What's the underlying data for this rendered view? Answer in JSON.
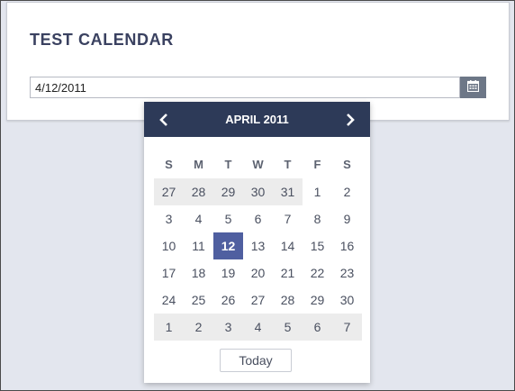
{
  "title": "TEST CALENDAR",
  "date_input": {
    "value": "4/12/2011"
  },
  "calendar_button_icon": "calendar-icon",
  "popup": {
    "month_label": "APRIL 2011",
    "prev_icon": "chevron-left-icon",
    "next_icon": "chevron-right-icon",
    "weekdays": [
      "S",
      "M",
      "T",
      "W",
      "T",
      "F",
      "S"
    ],
    "weeks": [
      [
        {
          "d": "27",
          "other": true
        },
        {
          "d": "28",
          "other": true
        },
        {
          "d": "29",
          "other": true
        },
        {
          "d": "30",
          "other": true
        },
        {
          "d": "31",
          "other": true
        },
        {
          "d": "1"
        },
        {
          "d": "2"
        }
      ],
      [
        {
          "d": "3"
        },
        {
          "d": "4"
        },
        {
          "d": "5"
        },
        {
          "d": "6"
        },
        {
          "d": "7"
        },
        {
          "d": "8"
        },
        {
          "d": "9"
        }
      ],
      [
        {
          "d": "10"
        },
        {
          "d": "11"
        },
        {
          "d": "12",
          "selected": true
        },
        {
          "d": "13"
        },
        {
          "d": "14"
        },
        {
          "d": "15"
        },
        {
          "d": "16"
        }
      ],
      [
        {
          "d": "17"
        },
        {
          "d": "18"
        },
        {
          "d": "19"
        },
        {
          "d": "20"
        },
        {
          "d": "21"
        },
        {
          "d": "22"
        },
        {
          "d": "23"
        }
      ],
      [
        {
          "d": "24"
        },
        {
          "d": "25"
        },
        {
          "d": "26"
        },
        {
          "d": "27"
        },
        {
          "d": "28"
        },
        {
          "d": "29"
        },
        {
          "d": "30"
        }
      ],
      [
        {
          "d": "1",
          "other": true
        },
        {
          "d": "2",
          "other": true
        },
        {
          "d": "3",
          "other": true
        },
        {
          "d": "4",
          "other": true
        },
        {
          "d": "5",
          "other": true
        },
        {
          "d": "6",
          "other": true
        },
        {
          "d": "7",
          "other": true
        }
      ]
    ],
    "today_label": "Today"
  },
  "colors": {
    "header_bg": "#2d3a58",
    "selected_bg": "#4f5fa0",
    "other_month_bg": "#ececec",
    "button_bg": "#6d7787",
    "page_bg": "#e3e6ee"
  }
}
